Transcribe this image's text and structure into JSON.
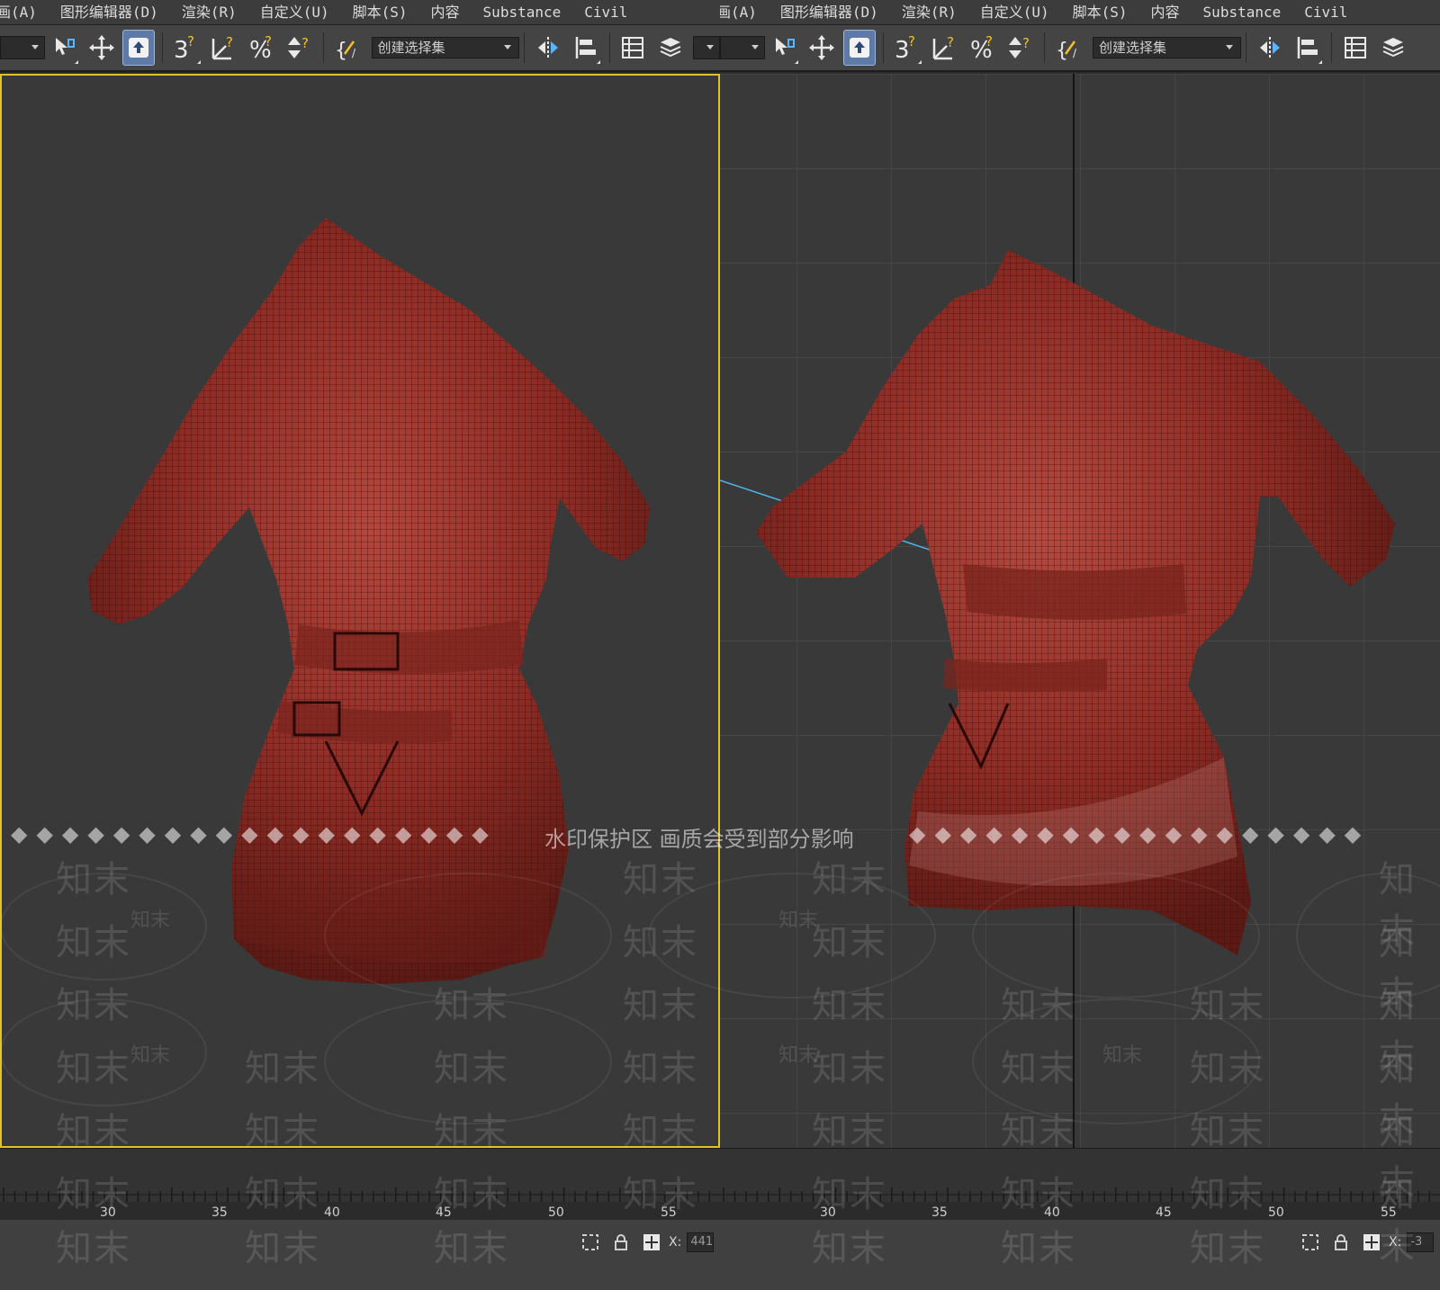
{
  "menubar": {
    "items": [
      "画(A)",
      "图形编辑器(D)",
      "渲染(R)",
      "自定义(U)",
      "脚本(S)",
      "内容",
      "Substance",
      "Civil"
    ]
  },
  "toolbar": {
    "selection_set_placeholder": "创建选择集",
    "icons": [
      "select-and-link-icon",
      "move-icon",
      "select-object-icon",
      "snap-3d-icon",
      "angle-snap-icon",
      "percent-snap-icon",
      "spinner-snap-icon",
      "edit-named-selection-icon",
      "mirror-icon",
      "align-icon",
      "scene-explorer-icon",
      "layer-manager-icon"
    ]
  },
  "viewports": {
    "left": {
      "active": true
    },
    "right": {
      "active": false
    }
  },
  "timeline": {
    "tick_labels": [
      "30",
      "35",
      "40",
      "45",
      "50",
      "55"
    ]
  },
  "status": {
    "x_label": "X:",
    "left_x_value": "441",
    "right_x_value": "-3"
  },
  "watermark": {
    "notice": "水印保护区  画质会受到部分影响",
    "brand": "知末"
  },
  "colors": {
    "viewport_bg": "#393939",
    "active_border": "#e1c22a",
    "garment": "#8a2a24",
    "toolbar_bg": "#444444",
    "menubar_bg": "#3c3c3c"
  }
}
